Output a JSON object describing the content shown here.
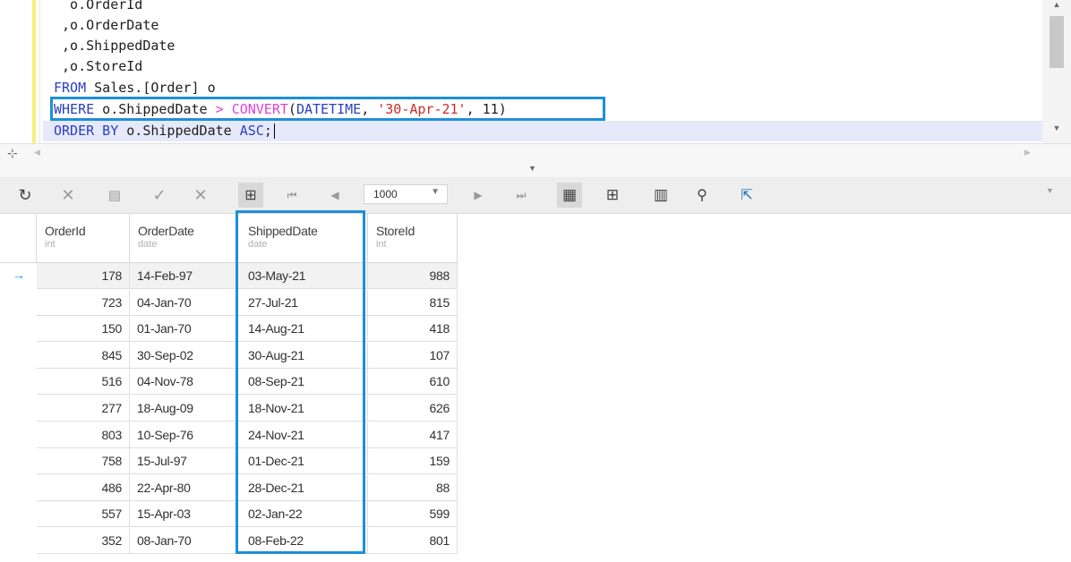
{
  "editor": {
    "lines": [
      {
        "tokens": [
          {
            "t": "  o.OrderId",
            "k": "plain"
          }
        ]
      },
      {
        "tokens": [
          {
            "t": " ,o.OrderDate",
            "k": "plain"
          }
        ]
      },
      {
        "tokens": [
          {
            "t": " ,o.ShippedDate",
            "k": "plain"
          }
        ]
      },
      {
        "tokens": [
          {
            "t": " ,o.StoreId",
            "k": "plain"
          }
        ]
      },
      {
        "tokens": [
          {
            "t": "FROM",
            "k": "kw"
          },
          {
            "t": " Sales.[Order] o",
            "k": "plain"
          }
        ]
      },
      {
        "tokens": [
          {
            "t": "WHERE",
            "k": "kw"
          },
          {
            "t": " o.ShippedDate ",
            "k": "plain"
          },
          {
            "t": ">",
            "k": "fn"
          },
          {
            "t": " ",
            "k": "plain"
          },
          {
            "t": "CONVERT",
            "k": "fn"
          },
          {
            "t": "(",
            "k": "plain"
          },
          {
            "t": "DATETIME",
            "k": "kw"
          },
          {
            "t": ", ",
            "k": "plain"
          },
          {
            "t": "'30-Apr-21'",
            "k": "str"
          },
          {
            "t": ", 11)",
            "k": "plain"
          }
        ]
      },
      {
        "tokens": [
          {
            "t": "ORDER BY",
            "k": "kw"
          },
          {
            "t": " o.ShippedDate ",
            "k": "plain"
          },
          {
            "t": "ASC",
            "k": "kw"
          },
          {
            "t": ";",
            "k": "plain"
          }
        ],
        "current": true
      }
    ]
  },
  "toolbar": {
    "icons": [
      "refresh-icon",
      "cancel-icon",
      "insert-row-icon",
      "apply-icon",
      "discard-icon",
      "grid-options-icon",
      "first-page-icon",
      "previous-page-icon",
      "next-page-icon",
      "last-page-icon",
      "grid-view-icon",
      "card-view-icon",
      "columns-icon",
      "find-icon",
      "export-icon"
    ],
    "rows_limit": "1000"
  },
  "grid": {
    "columns": [
      {
        "name": "OrderId",
        "type": "int"
      },
      {
        "name": "OrderDate",
        "type": "date"
      },
      {
        "name": "ShippedDate",
        "type": "date"
      },
      {
        "name": "StoreId",
        "type": "int"
      }
    ],
    "rows": [
      [
        "178",
        "14-Feb-97",
        "03-May-21",
        "988"
      ],
      [
        "723",
        "04-Jan-70",
        "27-Jul-21",
        "815"
      ],
      [
        "150",
        "01-Jan-70",
        "14-Aug-21",
        "418"
      ],
      [
        "845",
        "30-Sep-02",
        "30-Aug-21",
        "107"
      ],
      [
        "516",
        "04-Nov-78",
        "08-Sep-21",
        "610"
      ],
      [
        "277",
        "18-Aug-09",
        "18-Nov-21",
        "626"
      ],
      [
        "803",
        "10-Sep-76",
        "24-Nov-21",
        "417"
      ],
      [
        "758",
        "15-Jul-97",
        "01-Dec-21",
        "159"
      ],
      [
        "486",
        "22-Apr-80",
        "28-Dec-21",
        "88"
      ],
      [
        "557",
        "15-Apr-03",
        "02-Jan-22",
        "599"
      ],
      [
        "352",
        "08-Jan-70",
        "08-Feb-22",
        "801"
      ]
    ]
  },
  "colors": {
    "accent": "#1e8fd6",
    "keyword": "#2b3ec4",
    "function": "#e040d8",
    "string": "#d02a2a"
  }
}
